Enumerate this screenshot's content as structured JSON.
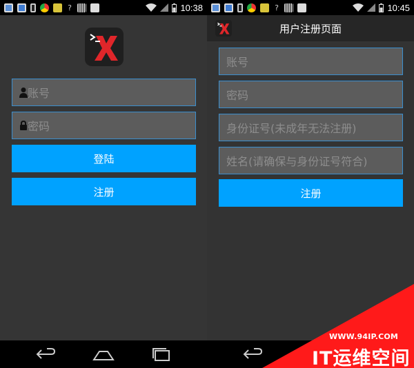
{
  "status_bar": {
    "time_left": "10:38",
    "time_right": "10:45"
  },
  "login": {
    "account_placeholder": "账号",
    "password_placeholder": "密码",
    "login_label": "登陆",
    "register_label": "注册"
  },
  "register": {
    "title": "用户注册页面",
    "account_placeholder": "账号",
    "password_placeholder": "密码",
    "id_placeholder": "身份证号(未成年无法注册)",
    "name_placeholder": "姓名(请确保与身份证号符合)",
    "register_label": "注册"
  },
  "watermark": {
    "url": "WWW.94IP.COM",
    "name": "IT运维空间"
  },
  "colors": {
    "accent": "#00a2ff",
    "field_border": "#3a8fcf",
    "background": "#353535",
    "watermark": "#ff1a1a"
  },
  "icons": [
    "gallery-icon",
    "photo-icon",
    "phone-icon",
    "chrome-icon",
    "note-icon",
    "question-icon",
    "barcode-icon",
    "download-icon",
    "wifi-icon",
    "signal-icon",
    "battery-icon",
    "person-icon",
    "lock-icon",
    "back-icon",
    "home-icon",
    "recent-apps-icon"
  ]
}
